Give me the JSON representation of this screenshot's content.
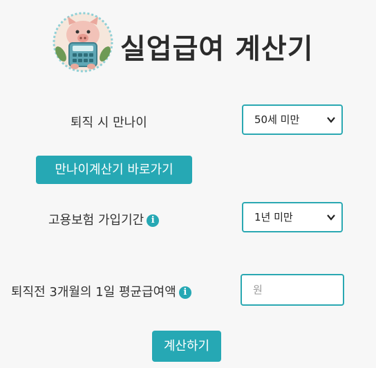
{
  "header": {
    "title": "실업급여 계산기"
  },
  "form": {
    "age": {
      "label": "퇴직 시 만나이",
      "value": "50세 미만"
    },
    "age_calc_button": "만나이계산기 바로가기",
    "insurance_period": {
      "label": "고용보험 가입기간",
      "value": "1년 미만"
    },
    "avg_wage": {
      "label": "퇴직전 3개월의 1일 평균급여액",
      "placeholder": "원"
    },
    "calculate_button": "계산하기"
  },
  "icons": {
    "info": "i",
    "dropdown": "chevron-down-icon"
  },
  "colors": {
    "accent": "#26a8b4"
  }
}
